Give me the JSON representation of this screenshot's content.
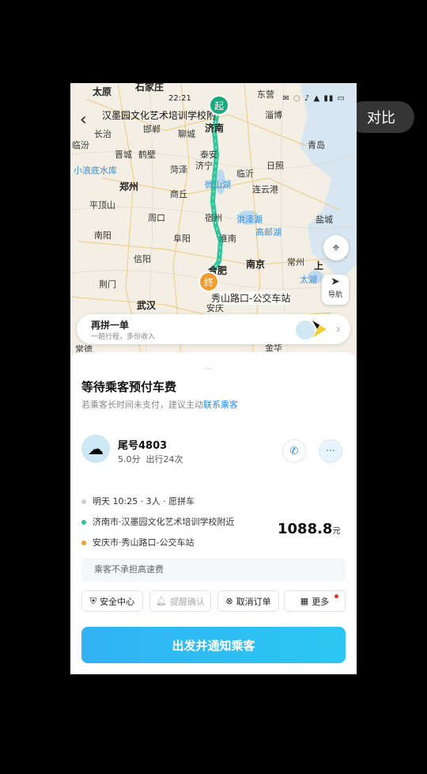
{
  "overlay": {
    "compare_label": "对比"
  },
  "status_bar": {
    "time": "22:21",
    "icons": "✉ ◌ ♪ ▲ ▮▮ ▭"
  },
  "map": {
    "title": "汉墨园文化艺术培训学校附",
    "start_marker": "起",
    "end_marker": "终",
    "end_label": "秀山路口-公交车站",
    "nav_label": "导航",
    "cities": [
      {
        "name": "太原",
        "cls": "big"
      },
      {
        "name": "石家庄",
        "cls": "big"
      },
      {
        "name": "东营",
        "cls": ""
      },
      {
        "name": "淄博",
        "cls": ""
      },
      {
        "name": "济南",
        "cls": "big"
      },
      {
        "name": "邯郸",
        "cls": ""
      },
      {
        "name": "聊城",
        "cls": ""
      },
      {
        "name": "长治",
        "cls": ""
      },
      {
        "name": "临汾",
        "cls": ""
      },
      {
        "name": "青岛",
        "cls": ""
      },
      {
        "name": "晋城",
        "cls": ""
      },
      {
        "name": "鹤壁",
        "cls": ""
      },
      {
        "name": "泰安",
        "cls": ""
      },
      {
        "name": "小浪底水库",
        "cls": "water"
      },
      {
        "name": "菏泽",
        "cls": ""
      },
      {
        "name": "济宁",
        "cls": ""
      },
      {
        "name": "日照",
        "cls": ""
      },
      {
        "name": "临沂",
        "cls": ""
      },
      {
        "name": "郑州",
        "cls": "big"
      },
      {
        "name": "微山湖",
        "cls": "water"
      },
      {
        "name": "商丘",
        "cls": ""
      },
      {
        "name": "连云港",
        "cls": ""
      },
      {
        "name": "平顶山",
        "cls": ""
      },
      {
        "name": "宿州",
        "cls": ""
      },
      {
        "name": "洪泽湖",
        "cls": "water"
      },
      {
        "name": "周口",
        "cls": ""
      },
      {
        "name": "盐城",
        "cls": ""
      },
      {
        "name": "南阳",
        "cls": ""
      },
      {
        "name": "阜阳",
        "cls": ""
      },
      {
        "name": "淮南",
        "cls": ""
      },
      {
        "name": "高邮湖",
        "cls": "water"
      },
      {
        "name": "信阳",
        "cls": ""
      },
      {
        "name": "合肥",
        "cls": "big"
      },
      {
        "name": "南京",
        "cls": "big"
      },
      {
        "name": "常州",
        "cls": ""
      },
      {
        "name": "荆门",
        "cls": ""
      },
      {
        "name": "太湖",
        "cls": "water"
      },
      {
        "name": "上",
        "cls": "big"
      },
      {
        "name": "武汉",
        "cls": "big"
      },
      {
        "name": "安庆",
        "cls": ""
      },
      {
        "name": "常德",
        "cls": ""
      },
      {
        "name": "金华",
        "cls": ""
      }
    ],
    "pool_card": {
      "title": "再拼一单",
      "subtitle": "一趟行程，多份收入"
    }
  },
  "sheet": {
    "handle": "︿",
    "title": "等待乘客预付车费",
    "subtitle_prefix": "若乘客长时间未支付，建议主动",
    "subtitle_link": "联系乘客",
    "passenger": {
      "tail_number": "尾号4803",
      "rating": "5.0分",
      "trips": "出行24次"
    },
    "trip_info": "明天 10:25 · 3人 · 愿拼车",
    "origin": "济南市·汉墨园文化艺术培训学校附近",
    "destination": "安庆市·秀山路口-公交车站",
    "price": "1088.8",
    "price_unit": "元",
    "note": "乘客不承担高速费",
    "actions": {
      "safety": "安全中心",
      "remind": "提醒确认",
      "cancel": "取消订单",
      "more": "更多"
    },
    "primary_button": "出发并通知乘客"
  },
  "colors": {
    "route": "#2fc49a",
    "accent": "#2a8be0",
    "primary_start": "#32b2f4",
    "end_marker": "#f39b2f"
  }
}
